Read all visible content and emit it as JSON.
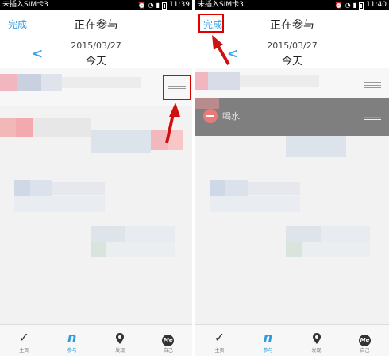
{
  "status": {
    "carrier": "未插入SIM卡3",
    "time_left": "11:39",
    "time_right": "11:40"
  },
  "header": {
    "done": "完成",
    "title": "正在参与",
    "date": "2015/03/27",
    "today": "今天",
    "back": "<"
  },
  "right_row": {
    "label": "喝水"
  },
  "tabs": [
    {
      "label": "主页",
      "icon": "checkmark-icon"
    },
    {
      "label": "参与",
      "icon": "n-icon"
    },
    {
      "label": "发现",
      "icon": "location-pin-icon"
    },
    {
      "label": "自己",
      "icon": "me-icon"
    }
  ],
  "tab_glyphs": {
    "home": "✓",
    "participate": "n",
    "me": "Me"
  },
  "colors": {
    "accent": "#38a3e0",
    "annotation_red": "#e00000",
    "overlay_gray": "#7f7f7f"
  }
}
